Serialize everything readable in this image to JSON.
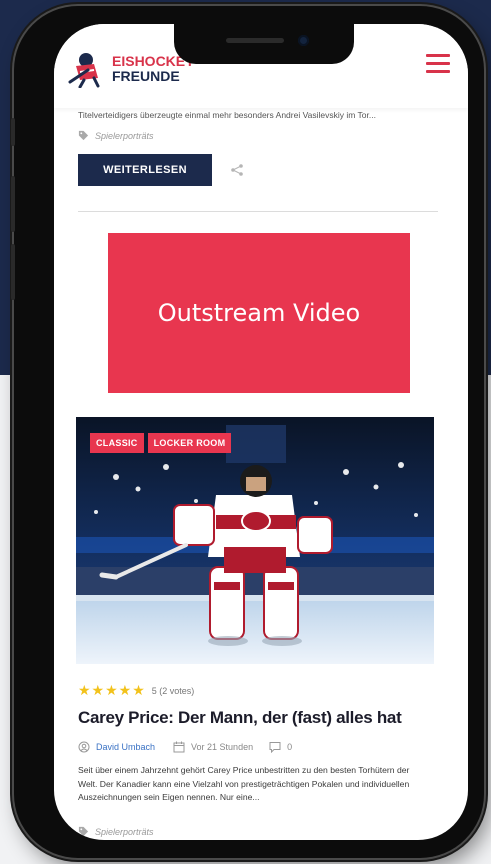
{
  "site": {
    "logo_line1": "EISHOCKEY",
    "logo_line2": "FREUNDE",
    "brand_red": "#d8334a",
    "brand_navy": "#1c2a4c"
  },
  "previous_article": {
    "excerpt_tail": "Titelverteidigers überzeugte einmal mehr besonders Andrei Vasilevskiy im Tor...",
    "tag": "Spielerporträts",
    "read_more_label": "WEITERLESEN"
  },
  "ad": {
    "label": "Outstream Video",
    "color": "#e8364f"
  },
  "article": {
    "categories": [
      "CLASSIC",
      "LOCKER ROOM"
    ],
    "stars": "★★★★★",
    "rating_text": "5 (2 votes)",
    "title": "Carey Price: Der Mann, der (fast) alles hat",
    "author": "David Umbach",
    "time": "Vor 21 Stunden",
    "comments": "0",
    "excerpt": "Seit über einem Jahrzehnt gehört Carey Price unbestritten zu den besten Torhütern der Welt. Der Kanadier kann eine Vielzahl von prestigeträchtigen Pokalen und individuellen Auszeichnungen sein Eigen nennen. Nur eine...",
    "tag": "Spielerporträts"
  }
}
